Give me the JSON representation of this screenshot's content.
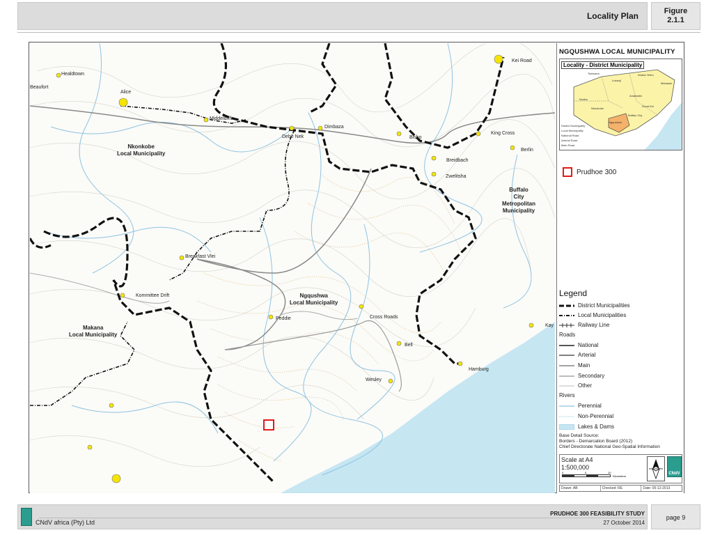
{
  "header": {
    "title": "Locality Plan",
    "figure_label": "Figure",
    "figure_number": "2.1.1"
  },
  "panel": {
    "title": "NGQUSHWA LOCAL MUNICIPALITY",
    "inset_title": "Locality - District Municipality",
    "inset_places": [
      "Tsolwana",
      "Intsika Yethu",
      "Mbhashe",
      "Lukanji",
      "Ngqushwa",
      "Amahlathi",
      "Nkonkobe",
      "Great Kei",
      "Nxuba",
      "Buffalo City"
    ],
    "inset_legend": [
      "District Municipality",
      "Local Municipality",
      "National Road",
      "Arterial Road",
      "Main Road"
    ],
    "site_label": "Prudhoe 300"
  },
  "legend": {
    "title": "Legend",
    "boundaries": [
      "District Municipalities",
      "Local Municipalities",
      "Railway Line"
    ],
    "roads_title": "Roads",
    "roads": [
      "National",
      "Arterial",
      "Main",
      "Secondary",
      "Other"
    ],
    "rivers_title": "Rivers",
    "rivers": [
      "Perennial",
      "Non-Perennial",
      "Lakes & Dams"
    ],
    "source_title": "Base Detail Source:",
    "source_line1": "Borders - Demarcation Board (2012)",
    "source_line2": "Chief Directorate National Geo-Spatial Information"
  },
  "scale": {
    "title": "Scale at A4",
    "ratio": "1:500,000",
    "ticks": [
      "0",
      "5",
      "10"
    ],
    "unit": "Kilometers"
  },
  "meta": {
    "drawn": "Drawn: AB",
    "checked": "Checked: RE",
    "date": "Date: 05-12-2013"
  },
  "map": {
    "places": [
      {
        "name": "Healdtown"
      },
      {
        "name": "Alice"
      },
      {
        "name": "Beaufort"
      },
      {
        "name": "Middeldrift"
      },
      {
        "name": "Debe Nek"
      },
      {
        "name": "Dimbaza"
      },
      {
        "name": "Bisho"
      },
      {
        "name": "King Cross"
      },
      {
        "name": "Berlin"
      },
      {
        "name": "Breidbach"
      },
      {
        "name": "Zwelitsha"
      },
      {
        "name": "Kei Road"
      },
      {
        "name": "Breakfast Vlei"
      },
      {
        "name": "Kommittee Drift"
      },
      {
        "name": "Peddie"
      },
      {
        "name": "Cross Roads"
      },
      {
        "name": "Bell"
      },
      {
        "name": "Hamburg"
      },
      {
        "name": "Wesley"
      },
      {
        "name": "Kay"
      }
    ],
    "municipalities": [
      {
        "line1": "Nkonkobe",
        "line2": "Local Municipality"
      },
      {
        "line1": "Buffalo",
        "line2": "City",
        "line3": "Metropolitan",
        "line4": "Municipality"
      },
      {
        "line1": "Ngqushwa",
        "line2": "Local Municipality"
      },
      {
        "line1": "Makana",
        "line2": "Local Municipality"
      }
    ]
  },
  "colors": {
    "ocean": "#c6e6f2",
    "river": "#8fc3e0",
    "boundary": "#111111",
    "site": "#e21a1a",
    "place": "#f5e400",
    "brand": "#2a9d8f"
  },
  "footer": {
    "company": "CNdV africa (Pty) Ltd",
    "study": "PRUDHOE 300 FEASIBILITY STUDY",
    "date": "27 October 2014",
    "page": "page 9",
    "logo_text": "CNdV"
  }
}
